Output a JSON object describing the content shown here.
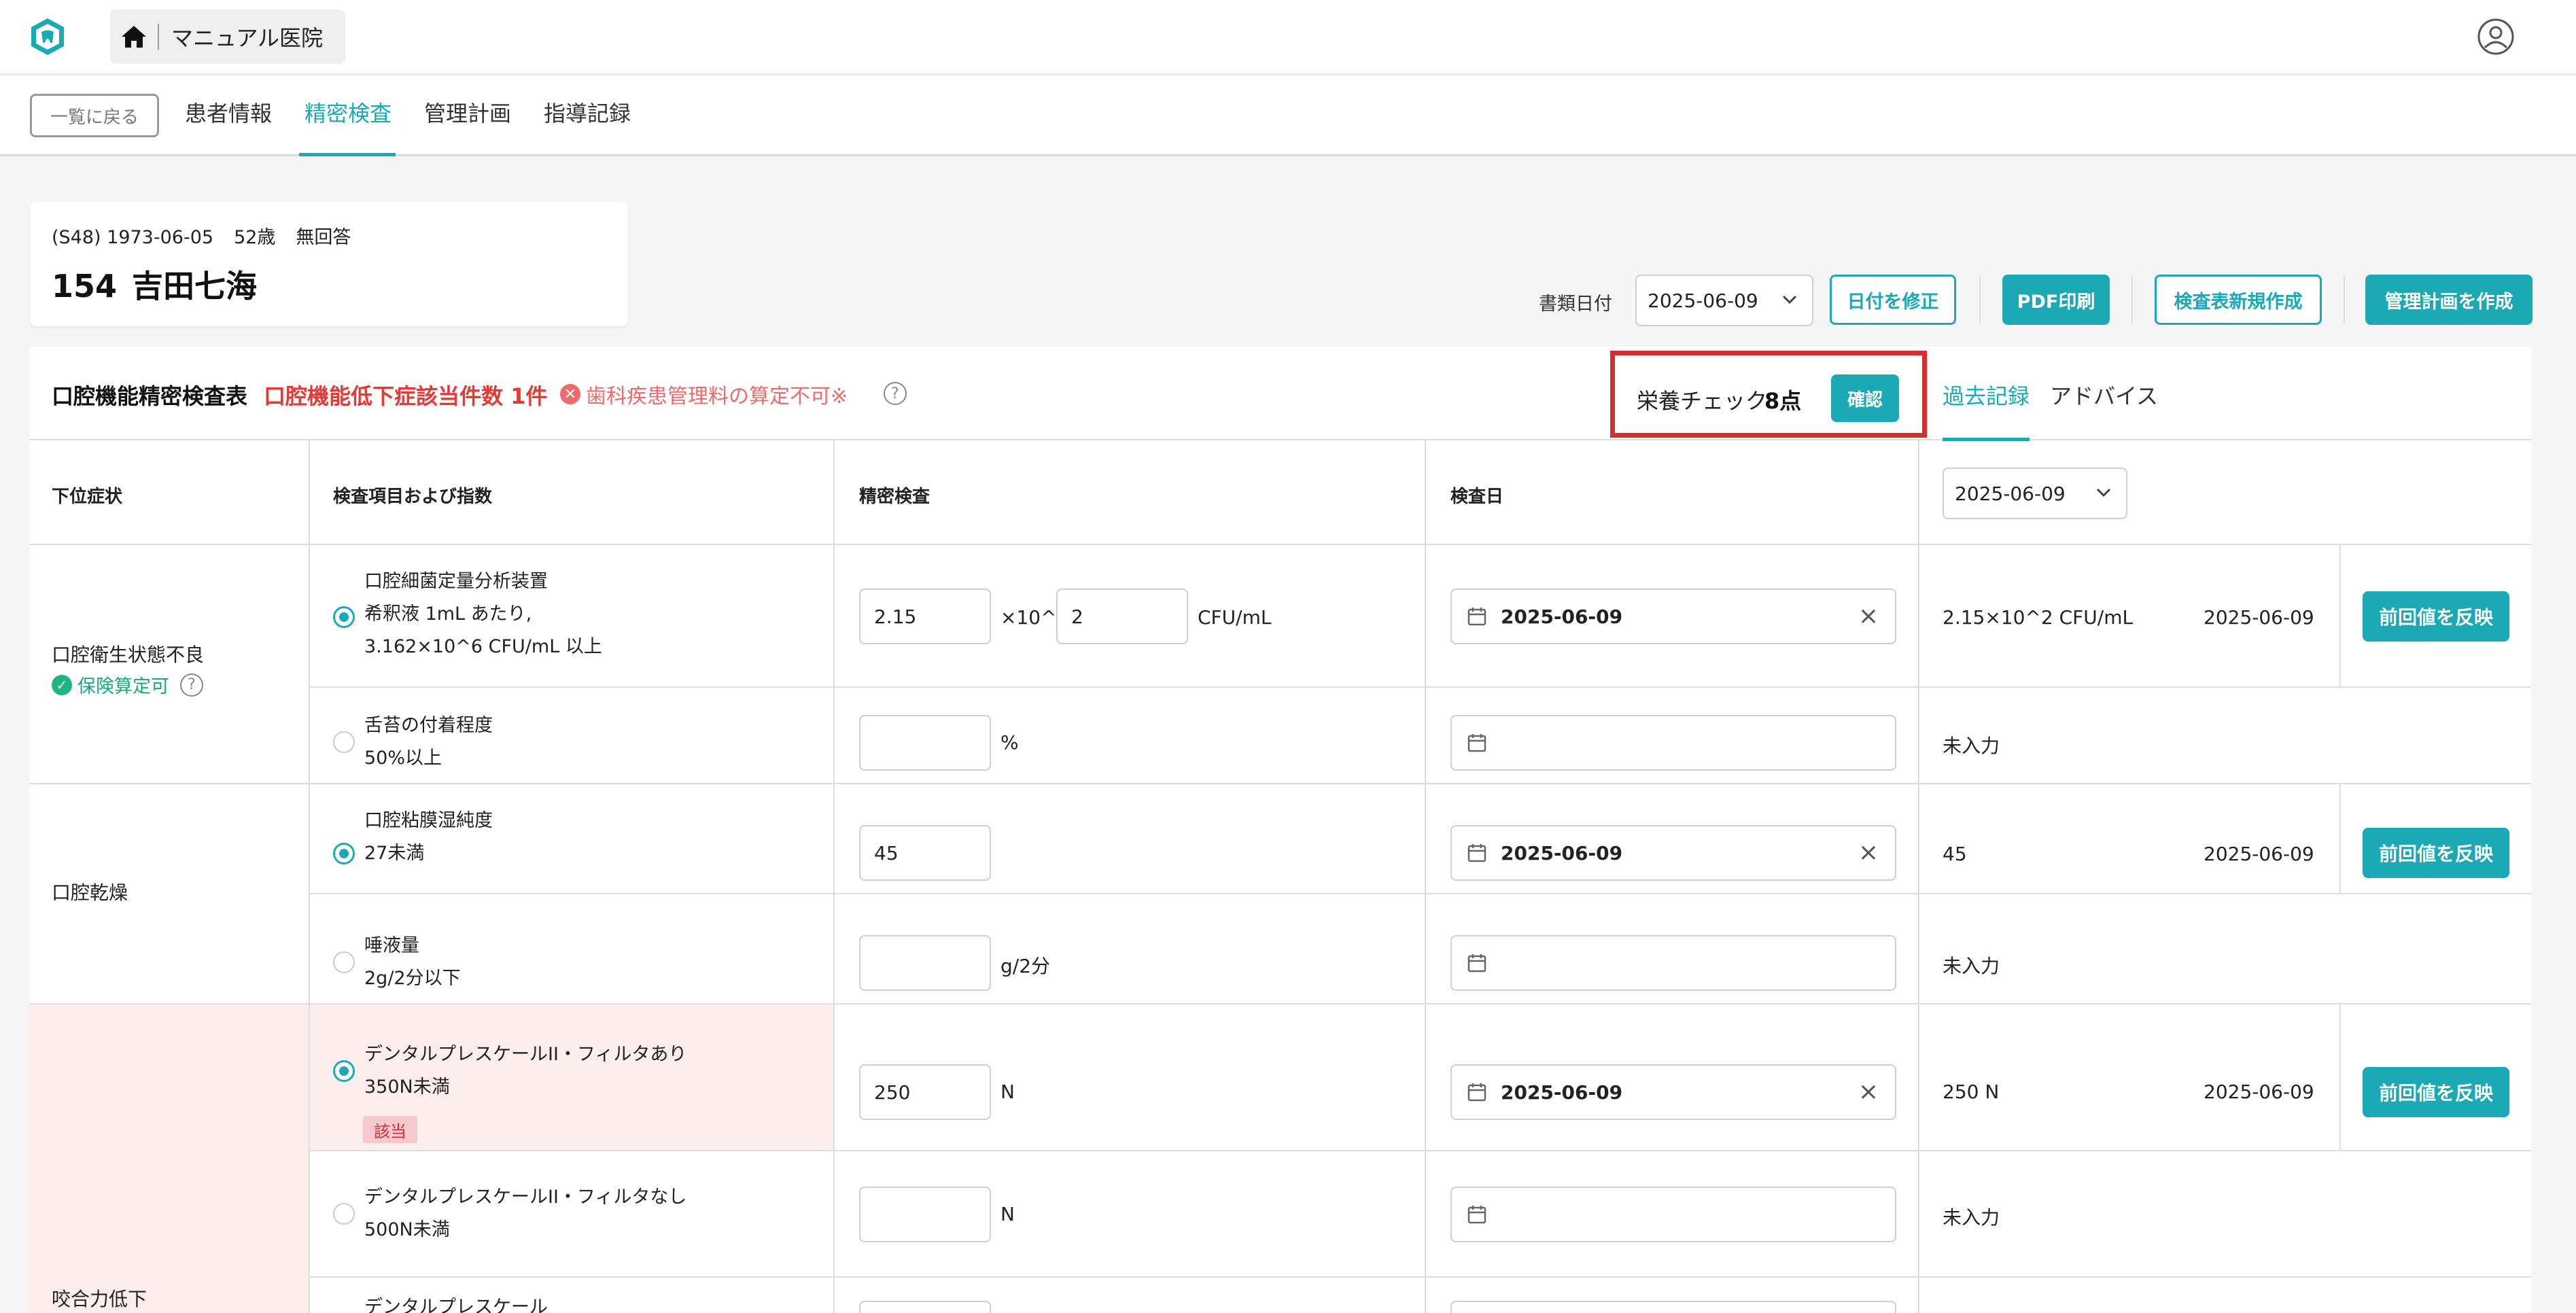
{
  "header": {
    "clinic_name": "マニュアル医院",
    "logo_icon": "tooth-shield-icon",
    "home_icon": "home-icon",
    "user_icon": "user-circle-icon"
  },
  "nav": {
    "back_label": "一覧に戻る",
    "tabs": [
      {
        "label": "患者情報",
        "active": false
      },
      {
        "label": "精密検査",
        "active": true
      },
      {
        "label": "管理計画",
        "active": false
      },
      {
        "label": "指導記録",
        "active": false
      }
    ]
  },
  "patient": {
    "era": "(S48) 1973-06-05",
    "age": "52歳",
    "gender": "無回答",
    "id": "154",
    "name": "吉田七海"
  },
  "toolbar": {
    "doc_date_label": "書類日付",
    "doc_date": "2025-06-09",
    "fix_date": "日付を修正",
    "pdf_print": "PDF印刷",
    "new_sheet": "検査表新規作成",
    "create_plan": "管理計画を作成"
  },
  "exam": {
    "title": "口腔機能精密検査表",
    "count_label": "口腔機能低下症該当件数 1件",
    "warning": "歯科疾患管理料の算定不可※",
    "nutrition_label": "栄養チェック",
    "nutrition_score": "8点",
    "confirm": "確認",
    "side_tabs": [
      "過去記録",
      "アドバイス"
    ],
    "columns": [
      "下位症状",
      "検査項目および指数",
      "精密検査",
      "検査日"
    ],
    "history_date": "2025-06-09",
    "reflect_label": "前回値を反映",
    "not_entered": "未入力",
    "groups": [
      {
        "symptom": "口腔衛生状態不良",
        "badge": "保険算定可"
      },
      {
        "symptom": "口腔乾燥"
      },
      {
        "symptom": "咬合力低下"
      }
    ],
    "rows": [
      {
        "item": [
          "口腔細菌定量分析装置",
          "希釈液 1mL あたり,",
          "3.162×10^6 CFU/mL 以上"
        ],
        "value": "2.15",
        "exp_label": "×10^",
        "exp": "2",
        "unit": "CFU/mL",
        "date": "2025-06-09",
        "prev_value": "2.15×10^2 CFU/mL",
        "prev_date": "2025-06-09"
      },
      {
        "item": [
          "舌苔の付着程度",
          "50%以上"
        ],
        "value": "",
        "unit": "%",
        "date": "",
        "prev_value": "未入力"
      },
      {
        "item": [
          "口腔粘膜湿純度",
          "27未満"
        ],
        "value": "45",
        "unit": "",
        "date": "2025-06-09",
        "prev_value": "45",
        "prev_date": "2025-06-09"
      },
      {
        "item": [
          "唾液量",
          "2g/2分以下"
        ],
        "value": "",
        "unit": "g/2分",
        "date": "",
        "prev_value": "未入力"
      },
      {
        "item": [
          "デンタルプレスケールII・フィルタあり",
          "350N未満"
        ],
        "tag": "該当",
        "value": "250",
        "unit": "N",
        "date": "2025-06-09",
        "prev_value": "250 N",
        "prev_date": "2025-06-09"
      },
      {
        "item": [
          "デンタルプレスケールII・フィルタなし",
          "500N未満"
        ],
        "value": "",
        "unit": "N",
        "date": "",
        "prev_value": "未入力"
      },
      {
        "item": [
          "デンタルプレスケール"
        ]
      }
    ]
  }
}
